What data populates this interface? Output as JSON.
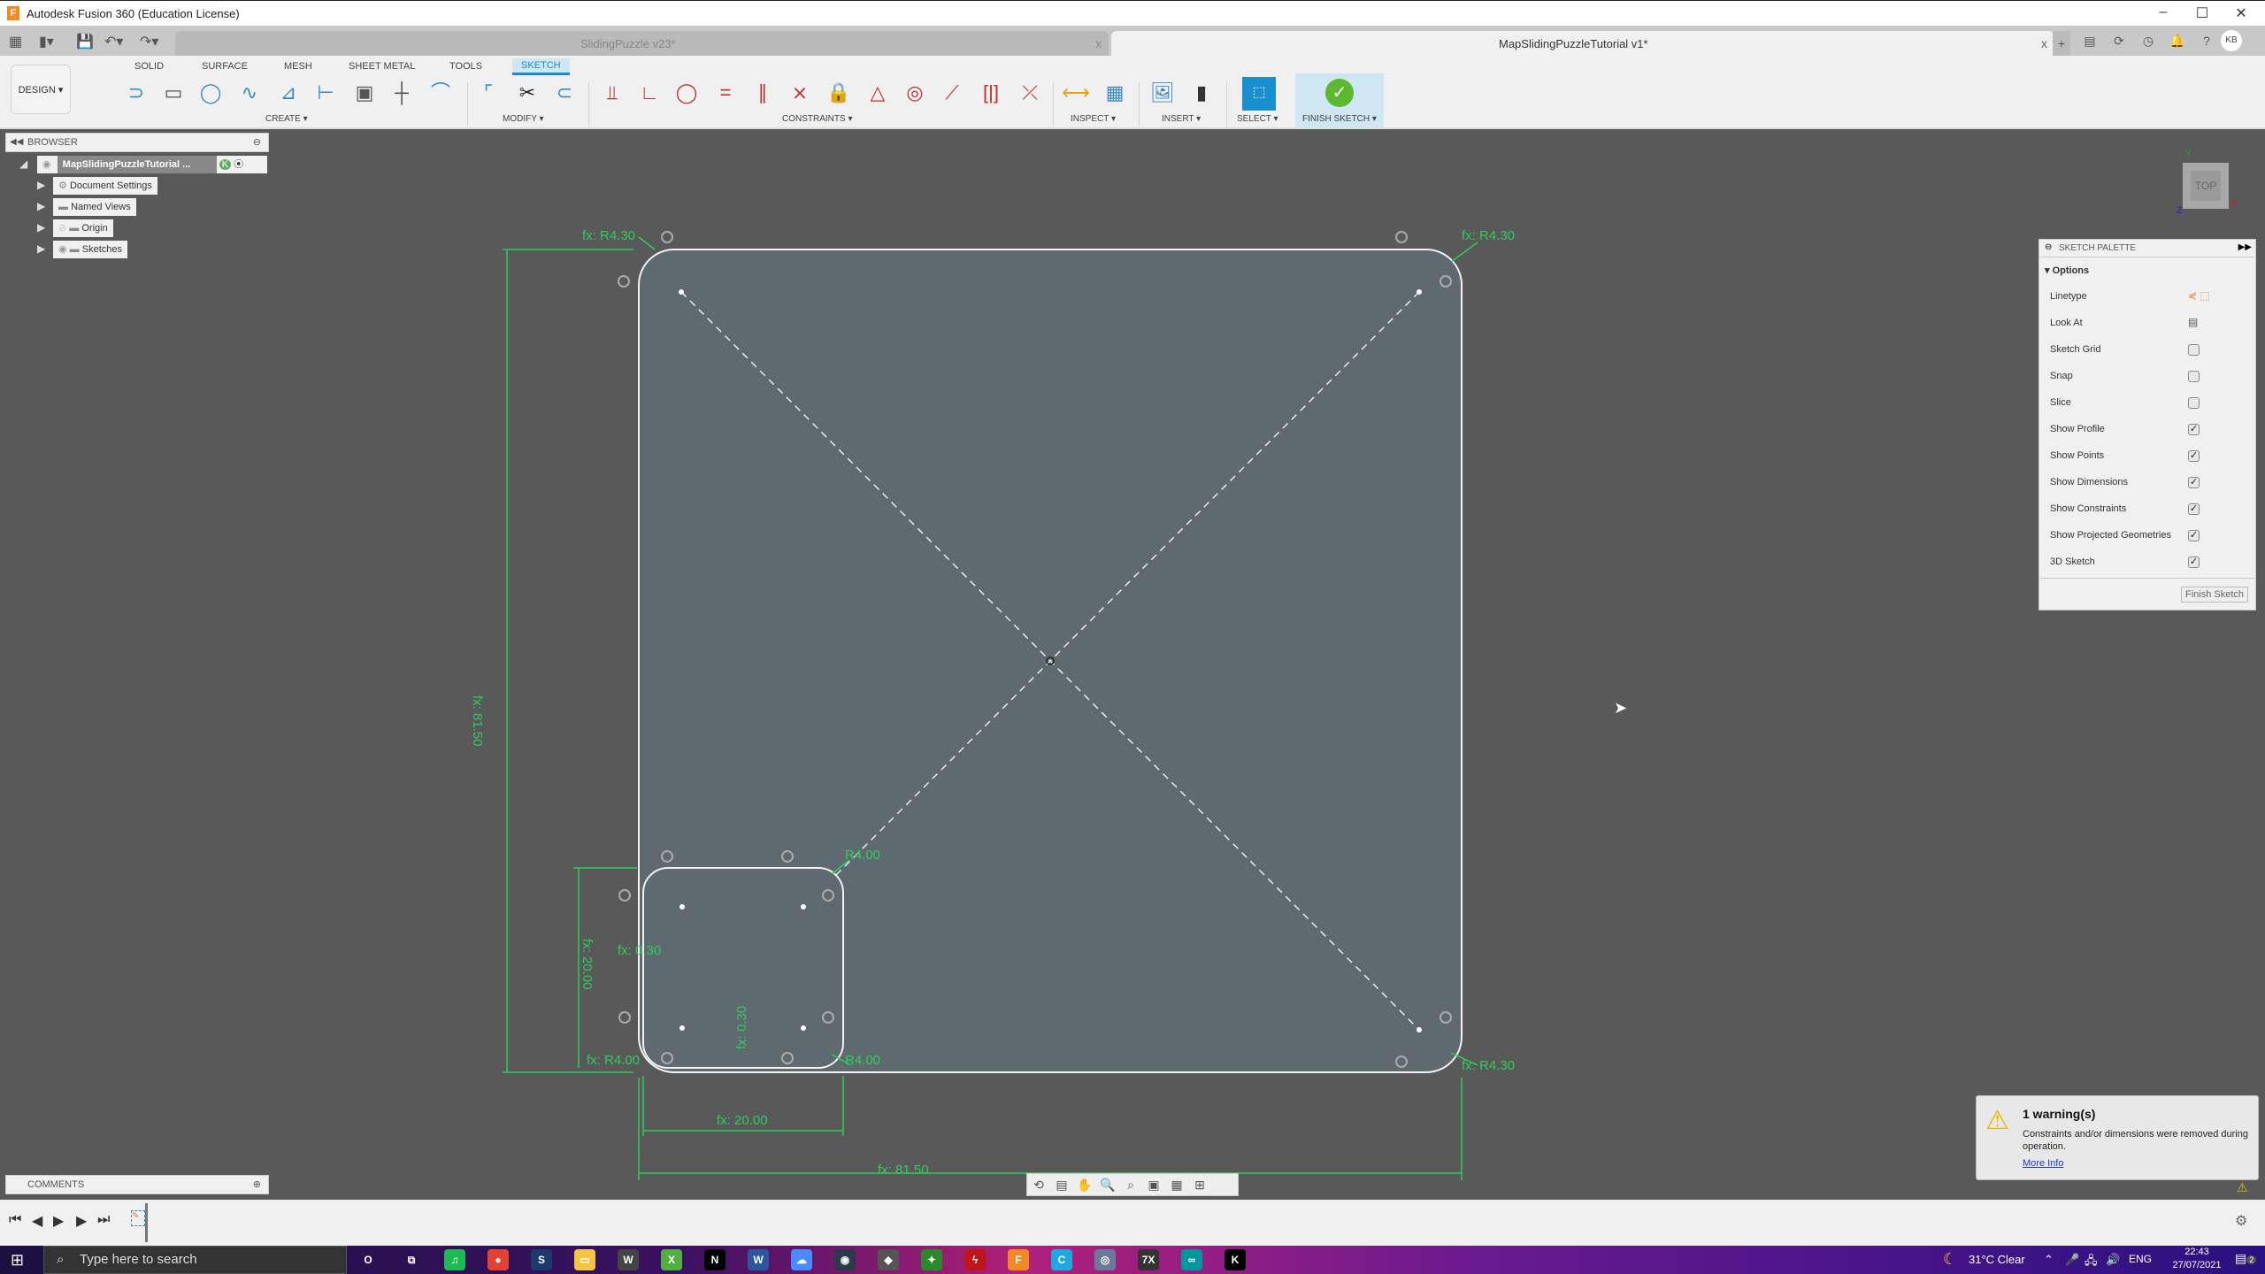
{
  "app": {
    "title": "Autodesk Fusion 360 (Education License)",
    "logo": "F"
  },
  "window_controls": {
    "minimize": "–",
    "maximize": "☐",
    "close": "✕"
  },
  "quick_access": {
    "grid_icon": "▦",
    "file_icon": "▮▾",
    "save_icon": "💾",
    "undo_icon": "↶▾",
    "redo_icon": "↷▾"
  },
  "tabs": [
    {
      "label": "SlidingPuzzle v23*",
      "close": "x",
      "active": false
    },
    {
      "label": "MapSlidingPuzzleTutorial v1*",
      "close": "x",
      "active": true
    }
  ],
  "top_right": {
    "new_tab": "+",
    "avatar": "KB"
  },
  "toolbar": {
    "workspace_button": "DESIGN ▾",
    "workspace_tabs": [
      "SOLID",
      "SURFACE",
      "MESH",
      "SHEET METAL",
      "TOOLS",
      "SKETCH"
    ],
    "active_tab": "SKETCH",
    "groups": {
      "create": "CREATE ▾",
      "modify": "MODIFY ▾",
      "constraints": "CONSTRAINTS ▾",
      "inspect": "INSPECT ▾",
      "insert": "INSERT ▾",
      "select": "SELECT ▾",
      "finish": "FINISH SKETCH ▾"
    }
  },
  "browser": {
    "title": "BROWSER",
    "root": "MapSlidingPuzzleTutorial ...",
    "items": [
      "Document Settings",
      "Named Views",
      "Origin",
      "Sketches"
    ]
  },
  "sketch_palette": {
    "title": "SKETCH PALETTE",
    "section": "Options",
    "rows": [
      {
        "label": "Linetype",
        "type": "icons"
      },
      {
        "label": "Look At",
        "type": "icon"
      },
      {
        "label": "Sketch Grid",
        "checked": false
      },
      {
        "label": "Snap",
        "checked": false
      },
      {
        "label": "Slice",
        "checked": false
      },
      {
        "label": "Show Profile",
        "checked": true
      },
      {
        "label": "Show Points",
        "checked": true
      },
      {
        "label": "Show Dimensions",
        "checked": true
      },
      {
        "label": "Show Constraints",
        "checked": true
      },
      {
        "label": "Show Projected Geometries",
        "checked": true
      },
      {
        "label": "3D Sketch",
        "checked": true
      }
    ],
    "finish_button": "Finish Sketch"
  },
  "viewcube": {
    "face": "TOP",
    "x_axis": "X",
    "y_axis": "Y",
    "z_axis": "Z"
  },
  "dimensions": {
    "top_left_radius": "fx: R4.30",
    "top_right_radius": "fx: R4.30",
    "bottom_right_radius": "fx: R4.30",
    "height": "fx: 81.50",
    "width": "fx: 81.50",
    "small_height": "fx: 20.00",
    "small_width": "fx: 20.00",
    "small_offset_x": "fx: 0.30",
    "small_offset_y": "fx: 0.30",
    "small_bl_radius": "fx: R4.00",
    "small_tr_radius": "R4.00",
    "small_br_radius": "R4.00"
  },
  "colors": {
    "dimension": "#2ecc5a",
    "sketch_line": "#ffffff",
    "profile_fill": "#5e6a70",
    "accent": "#1e8bc3"
  },
  "warning": {
    "title": "1 warning(s)",
    "message": "Constraints and/or dimensions were removed during operation.",
    "link": "More Info"
  },
  "comments": {
    "title": "COMMENTS"
  },
  "timeline": {
    "controls": [
      "⏮",
      "◀",
      "▶",
      "▶",
      "⏭"
    ]
  },
  "taskbar": {
    "search_placeholder": "Type here to search",
    "weather": "31°C  Clear",
    "language": "ENG",
    "time": "22:43",
    "date": "27/07/2021",
    "notifications": "2",
    "apps": [
      {
        "name": "cortana",
        "label": "O",
        "color": "transparent"
      },
      {
        "name": "task-view",
        "label": "⧉",
        "color": "transparent"
      },
      {
        "name": "spotify",
        "label": "♫",
        "color": "#1db954"
      },
      {
        "name": "chrome",
        "label": "●",
        "color": "#e34133"
      },
      {
        "name": "steam",
        "label": "S",
        "color": "#1b3a6b"
      },
      {
        "name": "file-explorer",
        "label": "▭",
        "color": "#f4c542"
      },
      {
        "name": "witcher",
        "label": "W",
        "color": "#444"
      },
      {
        "name": "xbox",
        "label": "X",
        "color": "#52b043"
      },
      {
        "name": "netflix",
        "label": "N",
        "color": "#000"
      },
      {
        "name": "word",
        "label": "W",
        "color": "#2b579a"
      },
      {
        "name": "cloud",
        "label": "☁",
        "color": "#4a8cff"
      },
      {
        "name": "davinci",
        "label": "◉",
        "color": "#2a3a4a"
      },
      {
        "name": "app-dark",
        "label": "◆",
        "color": "#555"
      },
      {
        "name": "xbox-game",
        "label": "✦",
        "color": "#2a8a2a"
      },
      {
        "name": "flash",
        "label": "ϟ",
        "color": "#c0151a"
      },
      {
        "name": "fusion360",
        "label": "F",
        "color": "#f08a24"
      },
      {
        "name": "cura",
        "label": "C",
        "color": "#1ea7e1"
      },
      {
        "name": "camera",
        "label": "◎",
        "color": "#6a7a9a"
      },
      {
        "name": "fx",
        "label": "7X",
        "color": "#333"
      },
      {
        "name": "arduino",
        "label": "∞",
        "color": "#00979c"
      },
      {
        "name": "k-app",
        "label": "K",
        "color": "#000"
      }
    ]
  }
}
